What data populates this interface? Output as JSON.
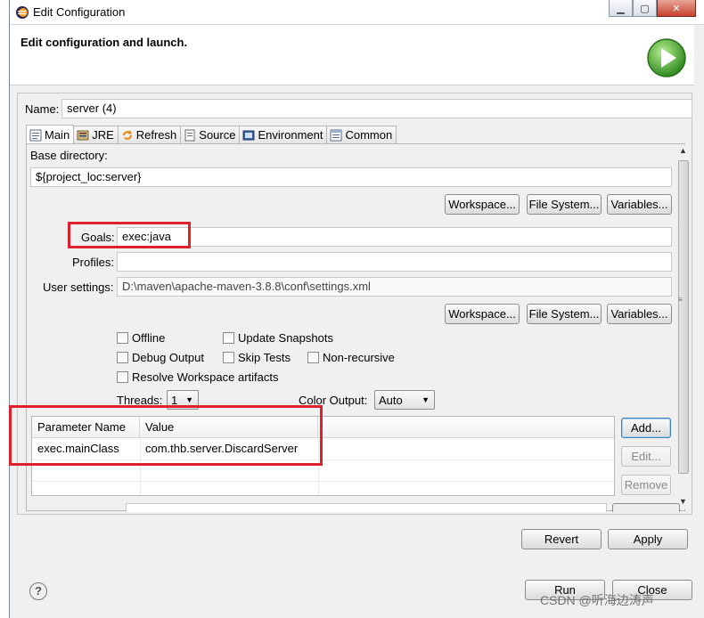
{
  "window": {
    "title": "Edit Configuration",
    "minimize": "▁",
    "maximize": "▢",
    "close": "✕"
  },
  "banner": {
    "text": "Edit configuration and launch."
  },
  "name": {
    "label": "Name:",
    "value": "server (4)"
  },
  "tabs": [
    {
      "label": "Main",
      "icon": "main-tab-icon",
      "active": true
    },
    {
      "label": "JRE",
      "icon": "jre-icon"
    },
    {
      "label": "Refresh",
      "icon": "refresh-icon"
    },
    {
      "label": "Source",
      "icon": "source-icon"
    },
    {
      "label": "Environment",
      "icon": "environment-icon"
    },
    {
      "label": "Common",
      "icon": "common-icon"
    }
  ],
  "main": {
    "base_dir_label": "Base directory:",
    "base_dir_value": "${project_loc:server}",
    "workspace_btn": "Workspace...",
    "filesystem_btn": "File System...",
    "variables_btn": "Variables...",
    "goals_label": "Goals:",
    "goals_value": "exec:java",
    "profiles_label": "Profiles:",
    "profiles_value": "",
    "user_settings_label": "User settings:",
    "user_settings_value": "D:\\maven\\apache-maven-3.8.8\\conf\\settings.xml",
    "checks": {
      "offline": "Offline",
      "update_snapshots": "Update Snapshots",
      "debug_output": "Debug Output",
      "skip_tests": "Skip Tests",
      "non_recursive": "Non-recursive",
      "resolve_workspace": "Resolve Workspace artifacts"
    },
    "threads_label": "Threads:",
    "threads_value": "1",
    "color_output_label": "Color Output:",
    "color_output_value": "Auto",
    "table": {
      "headers": [
        "Parameter Name",
        "Value"
      ],
      "rows": [
        [
          "exec.mainClass",
          "com.thb.server.DiscardServer"
        ]
      ]
    },
    "add_btn": "Add...",
    "edit_btn": "Edit...",
    "remove_btn": "Remove"
  },
  "footer": {
    "revert_btn": "Revert",
    "apply_btn": "Apply",
    "run_btn": "Run",
    "close_btn": "Close",
    "help": "?"
  },
  "watermark": "CSDN @听海边涛声",
  "colors": {
    "annotation": "#e0202a",
    "launch_green": "#3aa02c"
  }
}
